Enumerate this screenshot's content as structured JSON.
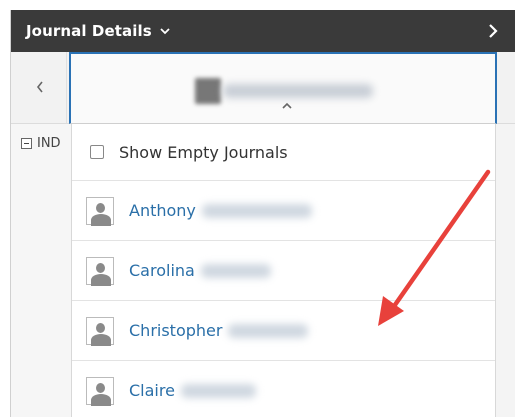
{
  "header": {
    "title": "Journal Details",
    "title_icon": "chevron-down-icon",
    "next_icon": "chevron-right-icon"
  },
  "subbar": {
    "back_icon": "chevron-left-icon",
    "selector_caret_icon": "caret-up-icon"
  },
  "left_panel": {
    "tree_label": "IND",
    "tree_icon": "collapse-minus-icon"
  },
  "dropdown": {
    "show_empty_label": "Show Empty Journals",
    "show_empty_checked": false,
    "users": [
      {
        "first_name": "Anthony"
      },
      {
        "first_name": "Carolina"
      },
      {
        "first_name": "Christopher"
      },
      {
        "first_name": "Claire"
      }
    ]
  },
  "annotation": {
    "arrow_color": "#e8413b"
  },
  "colors": {
    "header_bg": "#3a3a3a",
    "selector_border": "#2a72b5",
    "link_text": "#2a6fa8"
  }
}
